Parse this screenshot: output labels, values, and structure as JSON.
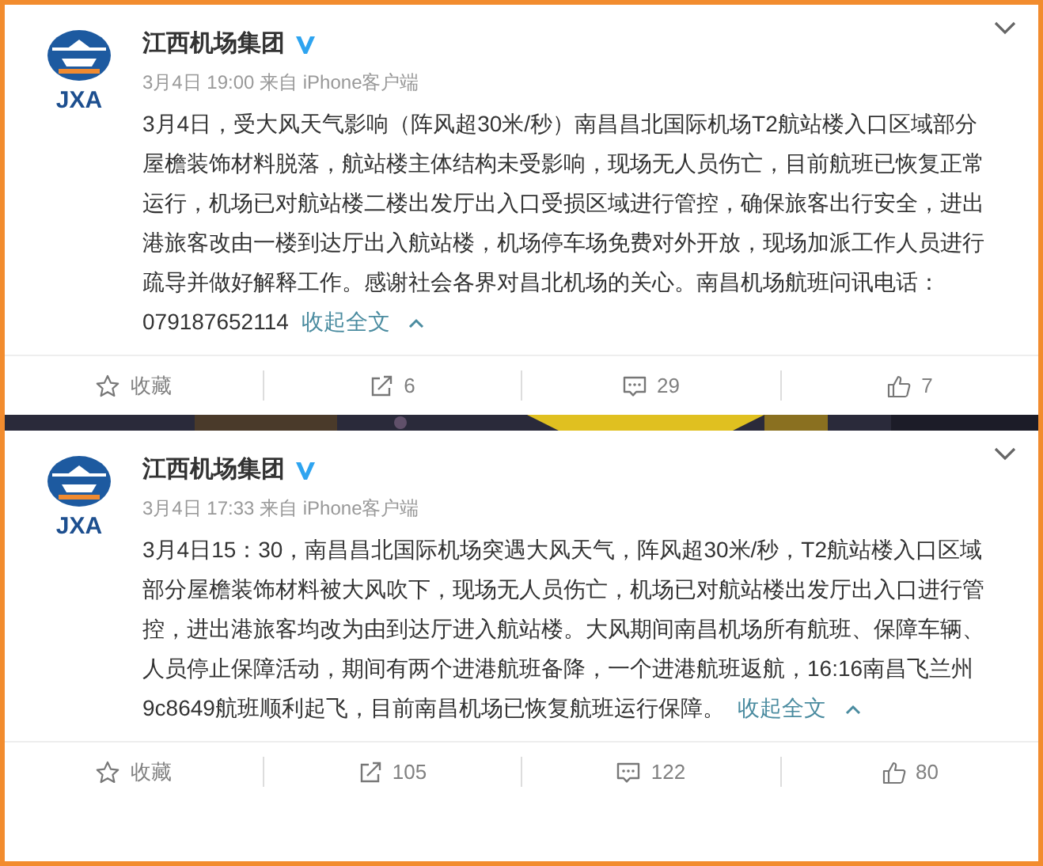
{
  "posts": [
    {
      "author": "江西机场集团",
      "verified": true,
      "logo_text": "JXA",
      "meta": "3月4日 19:00 来自 iPhone客户端",
      "text": "3月4日，受大风天气影响（阵风超30米/秒）南昌昌北国际机场T2航站楼入口区域部分屋檐装饰材料脱落，航站楼主体结构未受影响，现场无人员伤亡，目前航班已恢复正常运行，机场已对航站楼二楼出发厅出入口受损区域进行管控，确保旅客出行安全，进出港旅客改由一楼到达厅出入航站楼，机场停车场免费对外开放，现场加派工作人员进行疏导并做好解释工作。感谢社会各界对昌北机场的关心。南昌机场航班问讯电话：079187652114",
      "expand_link": "收起全文",
      "actions": [
        {
          "kind": "favorite",
          "label": "收藏"
        },
        {
          "kind": "repost",
          "label": "6"
        },
        {
          "kind": "comment",
          "label": "29"
        },
        {
          "kind": "like",
          "label": "7"
        }
      ]
    },
    {
      "author": "江西机场集团",
      "verified": true,
      "logo_text": "JXA",
      "meta": "3月4日 17:33 来自 iPhone客户端",
      "text": "3月4日15：30，南昌昌北国际机场突遇大风天气，阵风超30米/秒，T2航站楼入口区域部分屋檐装饰材料被大风吹下，现场无人员伤亡，机场已对航站楼出发厅出入口进行管控，进出港旅客均改为由到达厅进入航站楼。大风期间南昌机场所有航班、保障车辆、人员停止保障活动，期间有两个进港航班备降，一个进港航班返航，16:16南昌飞兰州9c8649航班顺利起飞，目前南昌机场已恢复航班运行保障。",
      "expand_link": "收起全文",
      "actions": [
        {
          "kind": "favorite",
          "label": "收藏"
        },
        {
          "kind": "repost",
          "label": "105"
        },
        {
          "kind": "comment",
          "label": "122"
        },
        {
          "kind": "like",
          "label": "80"
        }
      ]
    }
  ]
}
